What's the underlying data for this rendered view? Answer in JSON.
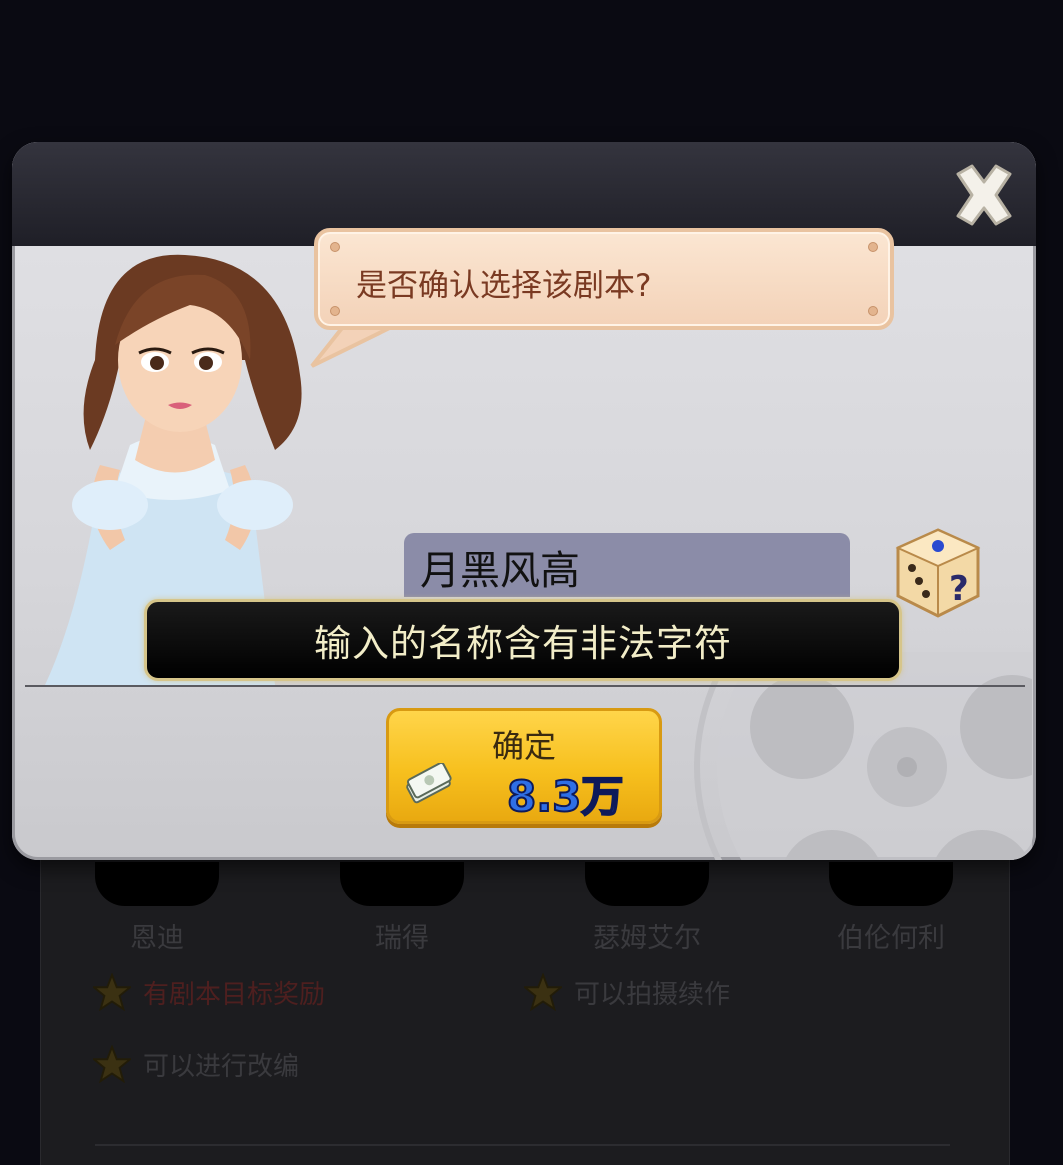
{
  "dialog": {
    "speech": "是否确认选择该剧本?",
    "script_name": "月黑风高",
    "toast": "输入的名称含有非法字符",
    "confirm_label": "确定",
    "cost": "8.3万"
  },
  "background": {
    "actors": [
      "恩迪",
      "瑞得",
      "瑟姆艾尔",
      "伯伦何利"
    ],
    "perks": [
      "有剧本目标奖励",
      "可以拍摄续作",
      "可以进行改编"
    ],
    "colors": {
      "perk_red": "#4e1f1f",
      "perk_gray": "#3a3a3e",
      "accent": "#f7c01e"
    }
  },
  "icons": [
    "close-icon",
    "dice-icon",
    "money-icon",
    "star-icon",
    "film-reel-icon"
  ]
}
